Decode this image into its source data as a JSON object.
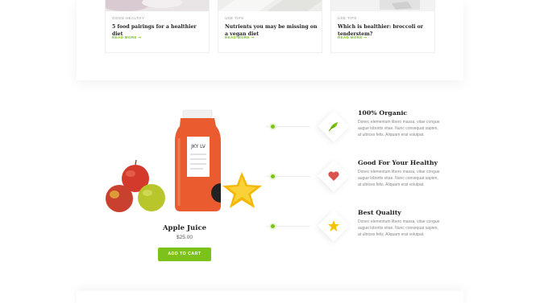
{
  "blog": {
    "posts": [
      {
        "category": "GOOD HEALTHY",
        "title": "5 food pairings for a healthier diet",
        "read_more": "READ MORE"
      },
      {
        "category": "USE TIPS",
        "title": "Nutrients you may be missing on a vegan diet",
        "read_more": "READ MORE"
      },
      {
        "category": "USE TIPS",
        "title": "Which is healthier: broccoli or tenderstem?",
        "read_more": "READ MORE"
      }
    ],
    "arrow_icon": "arrow-right-icon"
  },
  "product": {
    "name": "Apple Juice",
    "price": "$25.00",
    "add_to_cart": "ADD TO CART",
    "label_text": "JKY LV",
    "image": "juice-bottle-with-apples-and-starfruit"
  },
  "features": [
    {
      "title": "100% Organic",
      "icon": "leaf-icon",
      "text": "Donec elementum libero massa, vitae congue augue lobortis vitae. Nunc consequat sapien, at ultrices felis. Aliquam erat volutpat."
    },
    {
      "title": "Good For Your Healthy",
      "icon": "heart-icon",
      "text": "Donec elementum libero massa, vitae congue augue lobortis vitae. Nunc consequat sapien, at ultrices felis. Aliquam erat volutpat."
    },
    {
      "title": "Best Quality",
      "icon": "star-icon",
      "text": "Donec elementum libero massa, vitae congue augue lobortis vitae. Nunc consequat sapien, at ultrices felis. Aliquam erat volutpat."
    }
  ],
  "colors": {
    "accent": "#7cc21a",
    "heart": "#d9534f",
    "star": "#f5c400"
  }
}
